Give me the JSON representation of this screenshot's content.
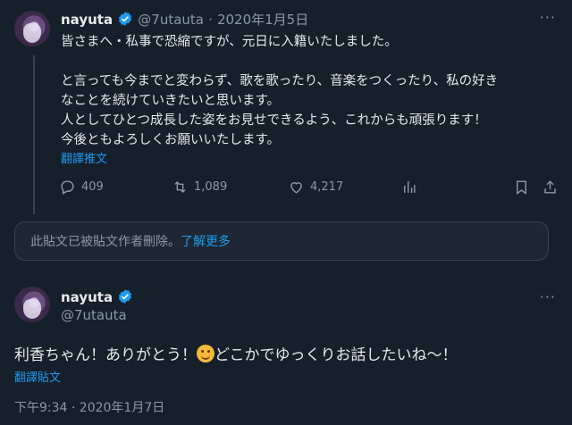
{
  "parent_tweet": {
    "display_name": "nayuta",
    "handle": "@7utauta",
    "date": "2020年1月5日",
    "more": "···",
    "lines": [
      "皆さまへ・私事で恐縮ですが、元日に入籍いたしました。",
      "",
      "と言っても今までと変わらず、歌を歌ったり、音楽をつくったり、私の好き",
      "なことを続けていきたいと思います。",
      "人としてひとつ成長した姿をお見せできるよう、これからも頑張ります！",
      "今後ともよろしくお願いいたします。"
    ],
    "translate": "翻譯推文",
    "replies": "409",
    "retweets": "1,089",
    "likes": "4,217",
    "icons": [
      "reply-icon",
      "retweet-icon",
      "like-icon",
      "views-icon",
      "bookmark-icon",
      "share-icon"
    ]
  },
  "deleted_notice": {
    "text": "此貼文已被貼文作者刪除。",
    "link": "了解更多"
  },
  "main_tweet": {
    "display_name": "nayuta",
    "handle": "@7utauta",
    "more": "···",
    "text_before": "利香ちゃん！ありがとう！",
    "emoji": "smiling-face-emoji",
    "text_after": "どこかでゆっくりお話したいね～！",
    "translate": "翻譯貼文",
    "timestamp": "下午9:34 · 2020年1月7日"
  },
  "colors": {
    "background": "#15202b",
    "accent": "#1d9bf0",
    "muted": "#8b98a5"
  }
}
